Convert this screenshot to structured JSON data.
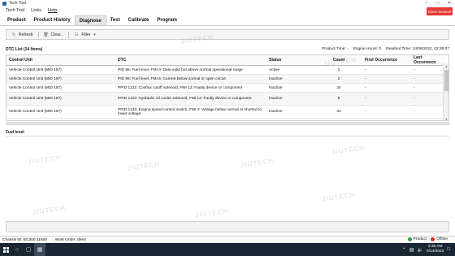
{
  "window": {
    "title": "Tech Tool"
  },
  "menu": {
    "items": [
      "Tech Tool",
      "Links",
      "Help"
    ],
    "close_button": "Close Session"
  },
  "tabs": [
    {
      "label": "Product",
      "active": false
    },
    {
      "label": "Product History",
      "active": false
    },
    {
      "label": "Diagnose",
      "active": true
    },
    {
      "label": "Test",
      "active": false
    },
    {
      "label": "Calibrate",
      "active": false
    },
    {
      "label": "Program",
      "active": false
    }
  ],
  "toolbar": {
    "refresh": "Refresh",
    "clear": "Clear...",
    "filter": "Filter"
  },
  "dtc": {
    "list_label": "DTC List (14 Items)",
    "product_time": "Product Time: -",
    "engine_hours": "Engine Hours: 0",
    "readout_time": "Readout Time: 14/06/2022, 02:35:07",
    "columns": [
      "Control Unit",
      "DTC",
      "Status",
      "Count",
      "First Occurrence",
      "Last Occurrence"
    ],
    "rows": [
      [
        "Vehicle Control Unit (MID 187)",
        "PID 96: Fuel level, FMI 0: Data valid but above normal operational range",
        "Active",
        "1",
        "-",
        "-"
      ],
      [
        "Vehicle Control Unit (MID 187)",
        "PID 96: Fuel level, FMI 5: Current below normal or open circuit",
        "Inactive",
        "2",
        "-",
        "-"
      ],
      [
        "Vehicle Control Unit (MID 187)",
        "PPID 1122: Conflux cutoff solenoid, FMI 12: Faulty device or component",
        "Inactive",
        "34",
        "-",
        "-"
      ],
      [
        "Vehicle Control Unit (MID 187)",
        "PPID 1123: Hydraulic oil cooler solenoid, FMI 12: Faulty device or component",
        "Inactive",
        "8",
        "-",
        "-"
      ],
      [
        "Vehicle Control Unit (MID 187)",
        "PPID 1133: Engine speed control switch, FMI 4: Voltage below normal or shorted to lower voltage",
        "Inactive",
        "31",
        "-",
        "-"
      ]
    ]
  },
  "detail": {
    "label": "Fuel level"
  },
  "status": {
    "chassis": "Chassis ID: EC300 11920",
    "work_order": "Work Order: dee4",
    "product": "Product",
    "offline": "Offline"
  },
  "taskbar": {
    "time": "2:35 AM",
    "date": "6/14/2022"
  },
  "watermark": "JIUTECH"
}
